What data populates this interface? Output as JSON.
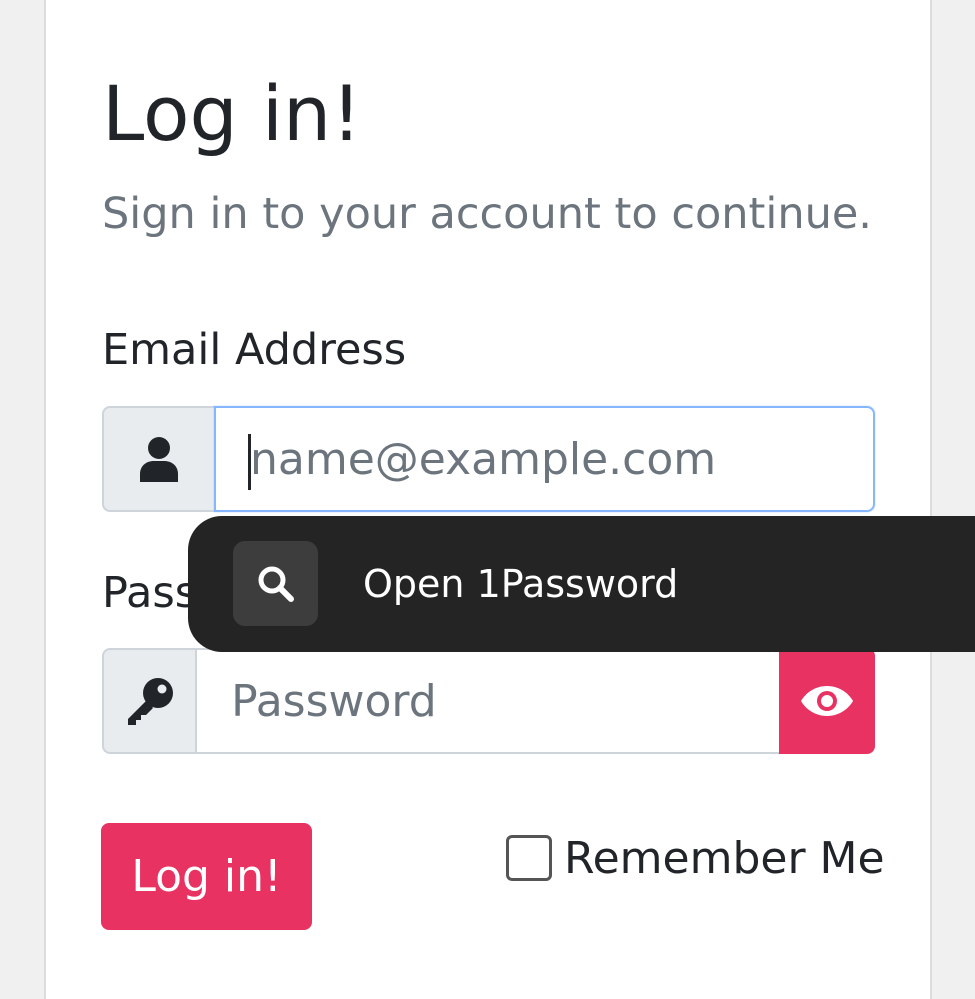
{
  "form": {
    "title": "Log in!",
    "subtitle": "Sign in to your account to continue.",
    "email_label": "Email Address",
    "email_placeholder": "name@example.com",
    "email_value": "",
    "password_label": "Pass",
    "password_placeholder": "Password",
    "password_value": "",
    "login_button_label": "Log in!",
    "remember_label": "Remember Me",
    "remember_checked": false
  },
  "autofill_popup": {
    "label": "Open 1Password",
    "icon": "search-icon"
  },
  "colors": {
    "accent": "#e83261",
    "popup_background": "#242424",
    "addon_background": "#e9ecef",
    "focus_border": "#86b7fe"
  },
  "icons": {
    "email_addon": "user-icon",
    "password_addon": "key-icon",
    "password_toggle": "eye-icon"
  }
}
